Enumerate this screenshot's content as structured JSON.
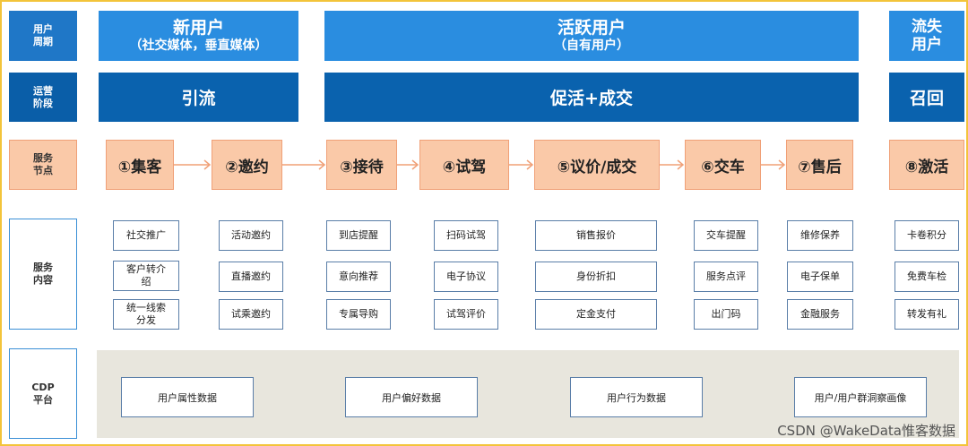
{
  "left_headers": {
    "lifecycle": [
      "用户",
      "周期"
    ],
    "stage": [
      "运营",
      "阶段"
    ],
    "node": [
      "服务",
      "节点"
    ],
    "content": [
      "服务",
      "内容"
    ],
    "cdp": [
      "CDP",
      "平台"
    ]
  },
  "lifecycle": {
    "new": {
      "title": "新用户",
      "subtitle": "（社交媒体，垂直媒体）"
    },
    "active": {
      "title": "活跃用户",
      "subtitle": "（自有用户）"
    },
    "lost": {
      "title": [
        "流失",
        "用户"
      ]
    }
  },
  "stages": {
    "attract": "引流",
    "promote": "促活+成交",
    "recall": "召回"
  },
  "nodes": [
    "①集客",
    "②邀约",
    "③接待",
    "④试驾",
    "⑤议价/成交",
    "⑥交车",
    "⑦售后",
    "⑧激活"
  ],
  "services": [
    [
      [
        "社交推广"
      ],
      [
        "客户转介",
        "绍"
      ],
      [
        "统一线索",
        "分发"
      ]
    ],
    [
      [
        "活动邀约"
      ],
      [
        "直播邀约"
      ],
      [
        "试乘邀约"
      ]
    ],
    [
      [
        "到店提醒"
      ],
      [
        "意向推荐"
      ],
      [
        "专属导购"
      ]
    ],
    [
      [
        "扫码试驾"
      ],
      [
        "电子协议"
      ],
      [
        "试驾评价"
      ]
    ],
    [
      [
        "销售报价"
      ],
      [
        "身份折扣"
      ],
      [
        "定金支付"
      ]
    ],
    [
      [
        "交车提醒"
      ],
      [
        "服务点评"
      ],
      [
        "出门码"
      ]
    ],
    [
      [
        "维修保养"
      ],
      [
        "电子保单"
      ],
      [
        "金融服务"
      ]
    ],
    [
      [
        "卡卷积分"
      ],
      [
        "免费车检"
      ],
      [
        "转发有礼"
      ]
    ]
  ],
  "cdp_items": [
    "用户属性数据",
    "用户偏好数据",
    "用户行为数据",
    "用户/用户群洞察画像"
  ],
  "watermark": "CSDN @WakeData惟客数据",
  "colors": {
    "lifecycle_blue": "#2a8de0",
    "stage_blue": "#0a62ae",
    "node_peach": "#fac9a8",
    "node_border": "#f0a077",
    "cdp_bg": "#e8e6dd",
    "frame": "#f3c43a"
  }
}
